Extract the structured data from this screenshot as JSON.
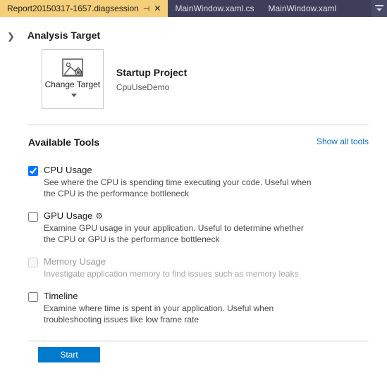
{
  "tabs": {
    "items": [
      {
        "label": "Report20150317-1657.diagsession",
        "active": true,
        "closeable": true,
        "pinned": true
      },
      {
        "label": "MainWindow.xaml.cs",
        "active": false
      },
      {
        "label": "MainWindow.xaml",
        "active": false
      }
    ]
  },
  "analysis": {
    "title": "Analysis Target",
    "change_label": "Change Target",
    "startup_heading": "Startup Project",
    "project_name": "CpuUseDemo"
  },
  "tools": {
    "title": "Available Tools",
    "show_all": "Show all tools",
    "items": [
      {
        "name": "CPU Usage",
        "desc": "See where the CPU is spending time executing your code. Useful when the CPU is the performance bottleneck",
        "checked": true,
        "enabled": true,
        "gear": false
      },
      {
        "name": "GPU Usage",
        "desc": "Examine GPU usage in your application. Useful to determine whether the CPU or GPU is the performance bottleneck",
        "checked": false,
        "enabled": true,
        "gear": true
      },
      {
        "name": "Memory Usage",
        "desc": "Investigate application memory to find issues such as memory leaks",
        "checked": false,
        "enabled": false,
        "gear": false
      },
      {
        "name": "Timeline",
        "desc": "Examine where time is spent in your application. Useful when troubleshooting issues like low frame rate",
        "checked": false,
        "enabled": true,
        "gear": false
      }
    ]
  },
  "actions": {
    "start": "Start"
  }
}
